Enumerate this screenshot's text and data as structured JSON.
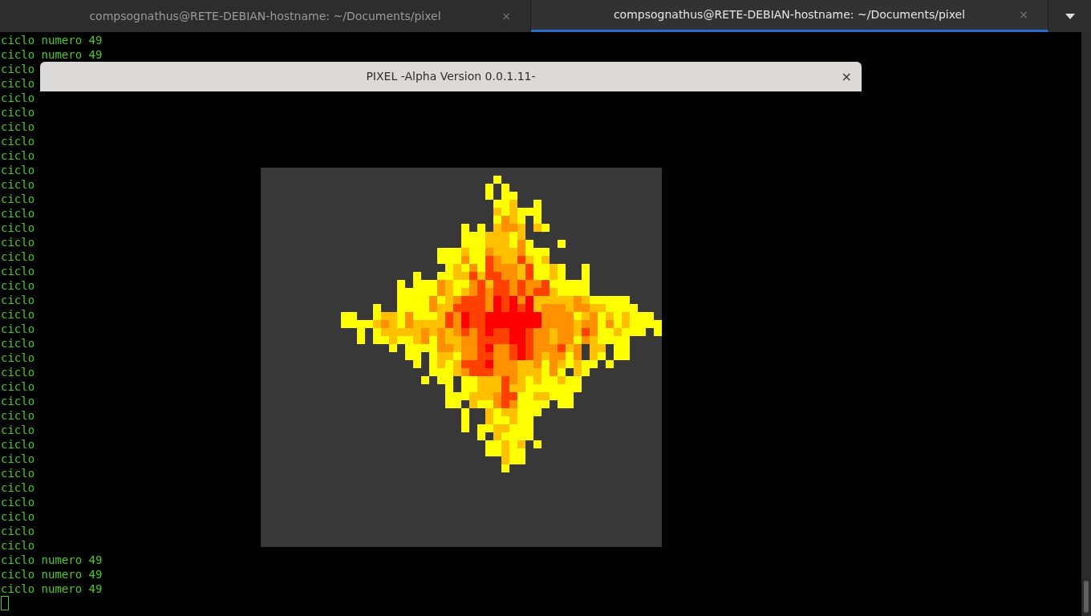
{
  "tabs": [
    {
      "title": "compsognathus@RETE-DEBIAN-hostname: ~/Documents/pixel",
      "close": "×",
      "selected": false
    },
    {
      "title": "compsognathus@RETE-DEBIAN-hostname: ~/Documents/pixel",
      "close": "×",
      "selected": true
    }
  ],
  "terminal": {
    "lines": [
      "ciclo numero 49",
      "ciclo numero 49",
      "ciclo",
      "ciclo",
      "ciclo",
      "ciclo",
      "ciclo",
      "ciclo",
      "ciclo",
      "ciclo",
      "ciclo",
      "ciclo",
      "ciclo",
      "ciclo",
      "ciclo",
      "ciclo",
      "ciclo",
      "ciclo",
      "ciclo",
      "ciclo",
      "ciclo",
      "ciclo",
      "ciclo",
      "ciclo",
      "ciclo",
      "ciclo",
      "ciclo",
      "ciclo",
      "ciclo",
      "ciclo",
      "ciclo",
      "ciclo",
      "ciclo",
      "ciclo",
      "ciclo",
      "ciclo",
      "ciclo numero 49",
      "ciclo numero 49",
      "ciclo numero 49"
    ],
    "cursor": true
  },
  "window": {
    "title": "PIXEL -Alpha Version 0.0.1.11-",
    "close": "×"
  }
}
